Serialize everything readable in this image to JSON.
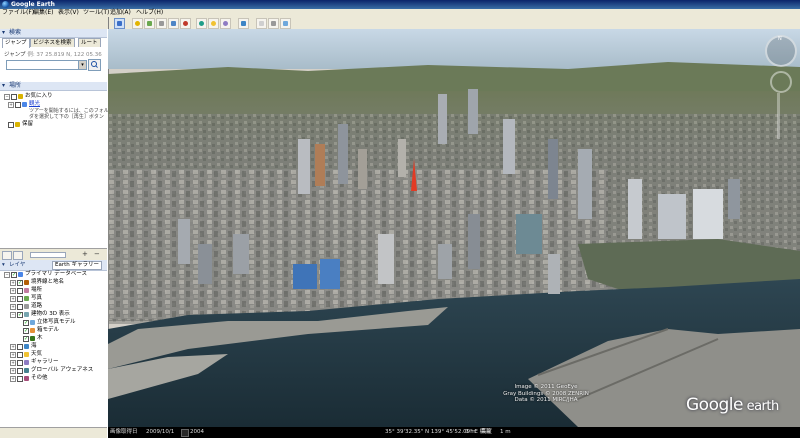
{
  "window": {
    "title": "Google Earth"
  },
  "menu": [
    "ファイル(F)",
    "編集(E)",
    "表示(V)",
    "ツール(T)",
    "追加(A)",
    "ヘルプ(H)"
  ],
  "search_panel": {
    "header": "検索",
    "tabs": [
      "ジャンプ",
      "ビジネスを検索",
      "ルート"
    ],
    "hint_label": "ジャンプ",
    "hint_example": "例: 37 25.819 N, 122 05.36",
    "input_value": ""
  },
  "places_panel": {
    "header": "場所",
    "items": [
      {
        "label": "お気に入り",
        "type": "folder"
      },
      {
        "label": "観光",
        "type": "link"
      },
      {
        "label": "保留",
        "type": "folder"
      }
    ],
    "tour_note_line1": "ツアーを開始するには、このフォル",
    "tour_note_line2": "ダを選択して下の［再生］ボタン"
  },
  "layers_panel": {
    "header": "レイヤ",
    "gallery_button": "Earth ギャラリー",
    "items": [
      {
        "label": "プライマリ データベース",
        "level": 0,
        "checked": true
      },
      {
        "label": "境界線と地名",
        "level": 1,
        "checked": true
      },
      {
        "label": "場所",
        "level": 1,
        "checked": false
      },
      {
        "label": "写真",
        "level": 1,
        "checked": false
      },
      {
        "label": "道路",
        "level": 1,
        "checked": false
      },
      {
        "label": "建物の 3D 表示",
        "level": 1,
        "checked": true
      },
      {
        "label": "立体写真モデル",
        "level": 2,
        "checked": true
      },
      {
        "label": "箱モデル",
        "level": 2,
        "checked": true
      },
      {
        "label": "木",
        "level": 2,
        "checked": true
      },
      {
        "label": "海",
        "level": 1,
        "checked": false
      },
      {
        "label": "天気",
        "level": 1,
        "checked": false
      },
      {
        "label": "ギャラリー",
        "level": 1,
        "checked": false
      },
      {
        "label": "グローバル アウェアネス",
        "level": 1,
        "checked": false
      },
      {
        "label": "その他",
        "level": 1,
        "checked": false
      }
    ]
  },
  "viewer": {
    "attribution": [
      "Image © 2011 GeoEye",
      "Gray Buildings © 2008 ZENRIN",
      "Data © 2011 MIRC/JHA"
    ],
    "logo_main": "Google",
    "logo_sub": "earth",
    "compass_label": "N"
  },
  "status_bar": {
    "imagery_date_label": "画像取得日",
    "imagery_date": "2009/10/1",
    "year": "2004",
    "coordinates": "35° 39'32.35\" N 139° 45'52.09\" E 標高",
    "elevation": "0 m",
    "eye_alt_label": "高度",
    "eye_alt": "1 m"
  },
  "colors": {
    "title_bar": "#0a246a",
    "panel_header": "#dde6f4",
    "water": "#1f3540",
    "sky": "#b4c8d6"
  }
}
